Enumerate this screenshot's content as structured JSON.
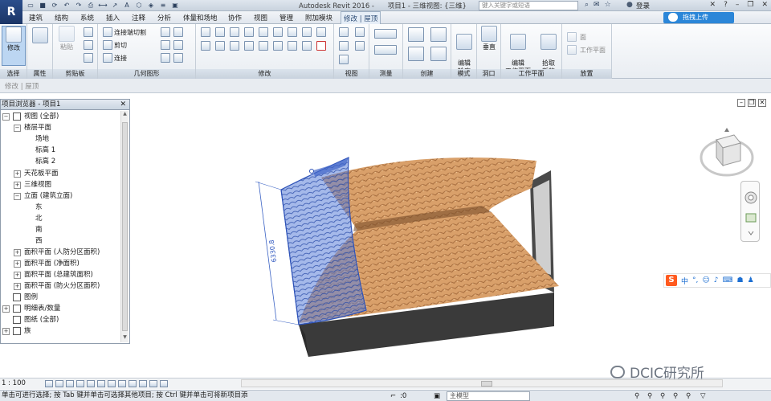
{
  "titlebar": {
    "app_logo": "R",
    "app_title": "Autodesk Revit 2016 -",
    "doc_title": "项目1 - 三维视图: {三维}",
    "search_placeholder": "键入关键字或短语",
    "login_label": "登录"
  },
  "menu": {
    "tabs": [
      "建筑",
      "结构",
      "系统",
      "插入",
      "注释",
      "分析",
      "体量和场地",
      "协作",
      "视图",
      "管理",
      "附加模块"
    ],
    "context_tab": "修改 | 屋顶",
    "cloud_button": "拖拽上传"
  },
  "ribbon": {
    "select": {
      "modify_label": "修改",
      "panel": "选择"
    },
    "properties": {
      "panel": "属性"
    },
    "clipboard": {
      "paste_label": "粘贴",
      "panel": "剪贴板"
    },
    "geometry": {
      "join_cut_label": "连接端切割",
      "cut_label": "剪切",
      "join_label": "连接",
      "panel": "几何图形"
    },
    "modify": {
      "panel": "修改"
    },
    "view": {
      "panel": "视图"
    },
    "measure": {
      "panel": "测量"
    },
    "create": {
      "panel": "创建"
    },
    "mode": {
      "edit_profile_label": "编辑\n轮廓",
      "panel": "模式"
    },
    "opening": {
      "vertical_label": "垂直",
      "panel": "洞口"
    },
    "workplane": {
      "edit_workplane_label": "编辑\n工作平面",
      "panel": "工作平面"
    },
    "pick_new": {
      "label": "拾取\n新的"
    },
    "placement": {
      "face_label": "面",
      "workplane_label": "工作平面",
      "panel": "放置"
    }
  },
  "subbar": {
    "text": "修改 | 屋顶"
  },
  "browser": {
    "title": "项目浏览器 - 项目1",
    "items": [
      {
        "label": "视图 (全部)",
        "toggle": "−"
      },
      {
        "label": "楼层平面",
        "toggle": "−"
      },
      {
        "label": "场地",
        "toggle": ""
      },
      {
        "label": "标高 1",
        "toggle": ""
      },
      {
        "label": "标高 2",
        "toggle": ""
      },
      {
        "label": "天花板平面",
        "toggle": "+"
      },
      {
        "label": "三维视图",
        "toggle": "+"
      },
      {
        "label": "立面 (建筑立面)",
        "toggle": "−"
      },
      {
        "label": "东",
        "toggle": ""
      },
      {
        "label": "北",
        "toggle": ""
      },
      {
        "label": "南",
        "toggle": ""
      },
      {
        "label": "西",
        "toggle": ""
      },
      {
        "label": "面积平面 (人防分区面积)",
        "toggle": "+"
      },
      {
        "label": "面积平面 (净面积)",
        "toggle": "+"
      },
      {
        "label": "面积平面 (总建筑面积)",
        "toggle": "+"
      },
      {
        "label": "面积平面 (防火分区面积)",
        "toggle": "+"
      },
      {
        "label": "图例",
        "toggle": ""
      },
      {
        "label": "明细表/数量",
        "toggle": "+"
      },
      {
        "label": "图纸 (全部)",
        "toggle": ""
      },
      {
        "label": "族",
        "toggle": "+"
      }
    ]
  },
  "viewport": {
    "dimension_value": "6330.8",
    "sogou": {
      "logo": "S",
      "lang": "中"
    }
  },
  "scale_bar": {
    "scale": "1 : 100"
  },
  "status": {
    "text": "单击可进行选择; 按 Tab 键并单击可选择其他项目; 按 Ctrl 键并单击可将新项目添",
    "worksets": ":0",
    "model": "主模型"
  },
  "watermark": {
    "text": "DCIC研究所"
  },
  "colors": {
    "roof_tile": "#d9a06a",
    "roof_shadow": "#7a4e2c",
    "selection_blue": "#3f64c8",
    "wall_dark": "#3a3a3a"
  }
}
